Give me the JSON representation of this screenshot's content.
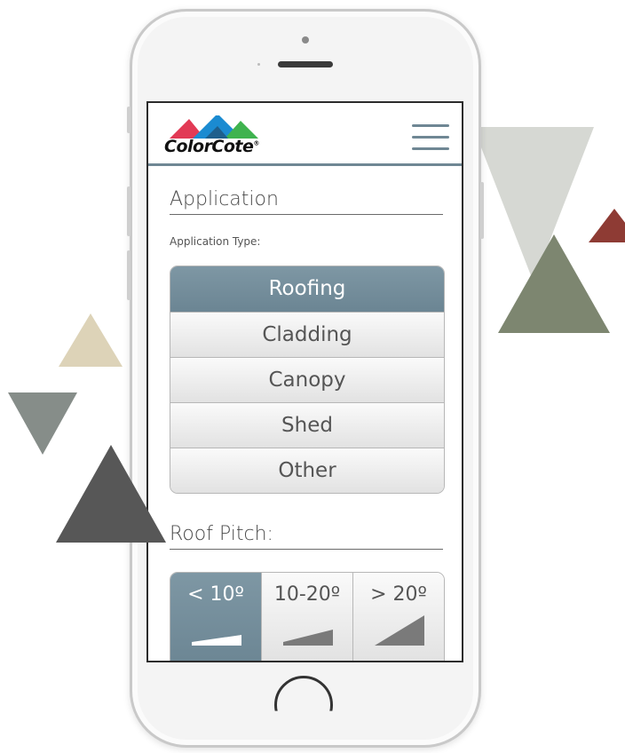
{
  "colors": {
    "accent": "#6f8794",
    "selected_bg": "#7390a0",
    "text": "#555555",
    "logo_red": "#e23a55",
    "logo_blue": "#1b8bd1",
    "logo_green": "#3fb34f"
  },
  "header": {
    "logo_text": "ColorCote",
    "logo_mark": "®",
    "menu_icon": "hamburger-icon"
  },
  "application": {
    "title": "Application",
    "type_label": "Application Type:",
    "options": [
      {
        "label": "Roofing",
        "selected": true
      },
      {
        "label": "Cladding",
        "selected": false
      },
      {
        "label": "Canopy",
        "selected": false
      },
      {
        "label": "Shed",
        "selected": false
      },
      {
        "label": "Other",
        "selected": false
      }
    ]
  },
  "roof_pitch": {
    "title": "Roof Pitch:",
    "options": [
      {
        "label": "< 10º",
        "selected": true,
        "icon": "low-slope-icon"
      },
      {
        "label": "10-20º",
        "selected": false,
        "icon": "medium-slope-icon"
      },
      {
        "label": "> 20º",
        "selected": false,
        "icon": "steep-slope-icon"
      }
    ]
  }
}
